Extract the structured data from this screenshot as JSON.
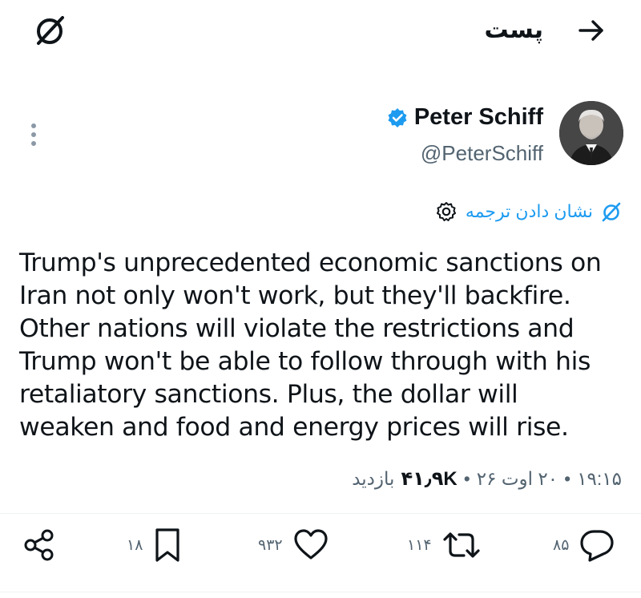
{
  "header": {
    "title": "پست",
    "logo_icon": "x-logo-icon",
    "back_icon": "arrow-right-icon"
  },
  "author": {
    "display_name": "Peter Schiff",
    "handle": "@PeterSchiff",
    "verified_icon": "verified-badge-icon",
    "verified_color": "#1d9bf0"
  },
  "translate": {
    "label": "نشان دادن ترجمه",
    "icon": "globe-icon",
    "settings_icon": "gear-icon",
    "color": "#1d9bf0"
  },
  "tweet": {
    "text": "Trump's unprecedented economic sanctions on\nIran not only won't work, but they'll backfire.\nOther nations will violate the restrictions and\nTrump won't be able to follow through with his\nretaliatory sanctions. Plus, the dollar will\nweaken and food and energy prices will rise."
  },
  "meta": {
    "time": "۱۹:۱۵",
    "date": "۲۰ اوت ۲۶",
    "views_count": "۴۱٫۹K",
    "views_label": "بازدید",
    "separator": "•"
  },
  "actions": {
    "replies": "۸۵",
    "reposts": "۱۱۴",
    "likes": "۹۳۲",
    "bookmarks": "۱۸"
  }
}
